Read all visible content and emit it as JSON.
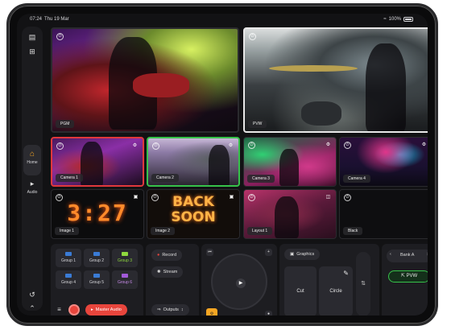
{
  "status": {
    "time": "07:24",
    "date": "Thu 19 Mar",
    "battery": "100%"
  },
  "rail": {
    "home_label": "Home",
    "audio_label": "Audio"
  },
  "tiles": {
    "pgm": "PGM",
    "pvw": "PVW",
    "camera1": "Camera 1",
    "camera2": "Camera 2",
    "camera3": "Camera 3",
    "camera4": "Camera 4",
    "image1": "Image 1",
    "image2": "Image 2",
    "layout1": "Layout 1",
    "black": "Black"
  },
  "image_content": {
    "clock": "3:27",
    "back": "BACK",
    "soon": "SOON"
  },
  "groups": [
    {
      "label": "Group 1",
      "color": "#3a7bd5",
      "active": false
    },
    {
      "label": "Group 2",
      "color": "#3a7bd5",
      "active": false
    },
    {
      "label": "Group 3",
      "color": "#8fd93e",
      "active": true
    },
    {
      "label": "Group 4",
      "color": "#3a7bd5",
      "active": false
    },
    {
      "label": "Group 5",
      "color": "#3a7bd5",
      "active": false
    },
    {
      "label": "Group 6",
      "color": "#a25ad9",
      "active": true
    }
  ],
  "audio": {
    "master_label": "Master Audio"
  },
  "record": {
    "record_label": "Record",
    "stream_label": "Stream",
    "outputs_label": "Outputs"
  },
  "transitions": {
    "graphics_label": "Graphics",
    "cut_label": "Cut",
    "circle_label": "Circle"
  },
  "bank": {
    "label": "Bank A",
    "pvw_label": "PVW"
  },
  "colors": {
    "program_tally": "#e0383c",
    "preview_tally": "#36c24a",
    "accent": "#f5a623",
    "record": "#e8453c"
  }
}
